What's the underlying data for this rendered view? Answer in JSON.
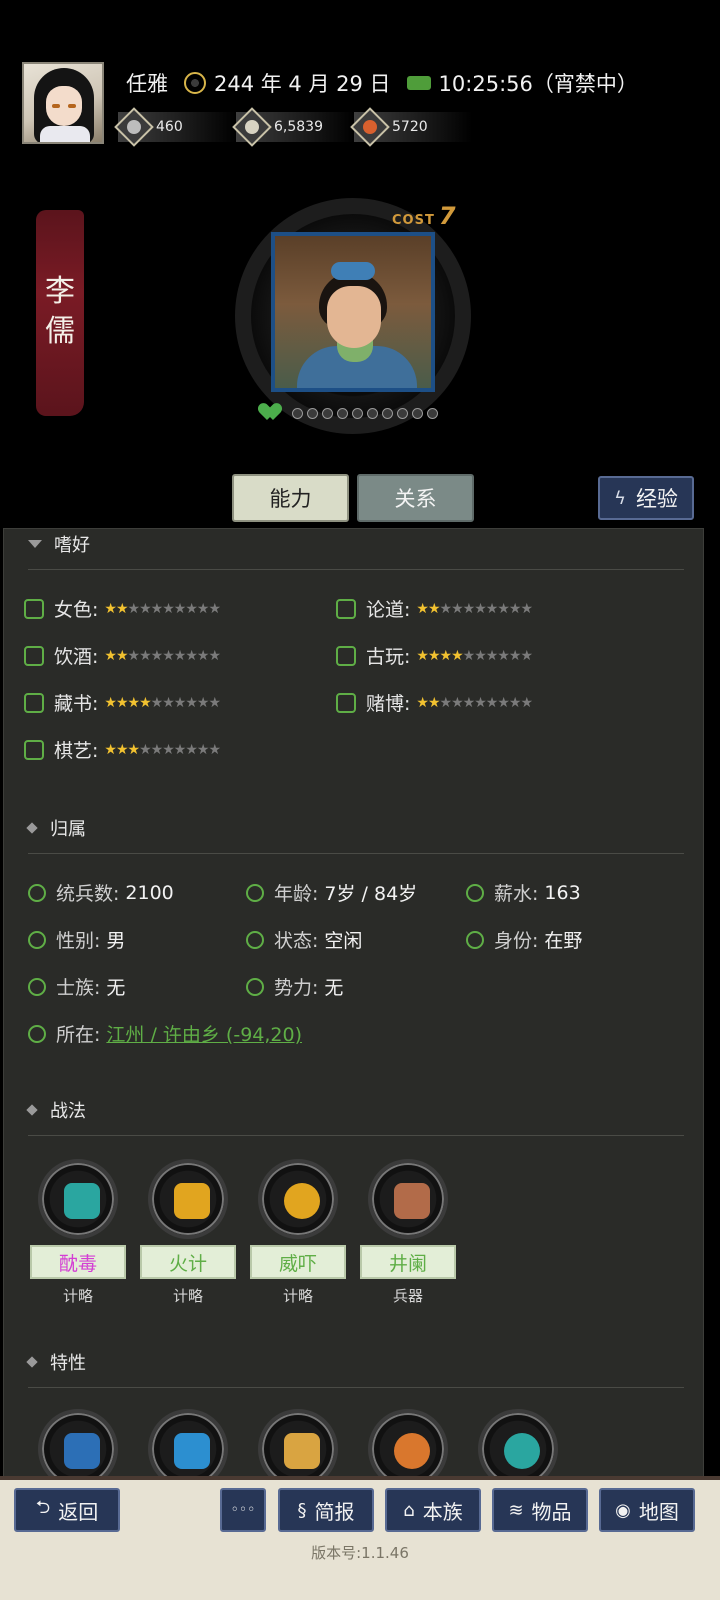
{
  "header": {
    "player_name": "任雅",
    "date": "244 年 4 月 29 日",
    "time": "10:25:56（宵禁中）",
    "resources": [
      {
        "icon": "coin-icon",
        "value": "460"
      },
      {
        "icon": "grain-icon",
        "value": "6,5839"
      },
      {
        "icon": "meat-icon",
        "value": "5720"
      }
    ]
  },
  "character": {
    "name_line1": "李",
    "name_line2": "儒",
    "cost_label": "COST",
    "cost_value": "7"
  },
  "tabs": {
    "ability": "能力",
    "relation": "关系",
    "experience": "经验"
  },
  "hobbies": {
    "section_title": "嗜好",
    "items": [
      {
        "label": "女色:",
        "stars": 2
      },
      {
        "label": "论道:",
        "stars": 1.5
      },
      {
        "label": "饮酒:",
        "stars": 2
      },
      {
        "label": "古玩:",
        "stars": 4
      },
      {
        "label": "藏书:",
        "stars": 4
      },
      {
        "label": "赌博:",
        "stars": 2
      },
      {
        "label": "棋艺:",
        "stars": 3
      }
    ]
  },
  "belong": {
    "section_title": "归属",
    "troops_label": "统兵数:",
    "troops_value": "2100",
    "age_label": "年龄:",
    "age_value": "7岁 / 84岁",
    "salary_label": "薪水:",
    "salary_value": "163",
    "gender_label": "性别:",
    "gender_value": "男",
    "status_label": "状态:",
    "status_value": "空闲",
    "identity_label": "身份:",
    "identity_value": "在野",
    "clan_label": "士族:",
    "clan_value": "无",
    "faction_label": "势力:",
    "faction_value": "无",
    "location_label": "所在:",
    "location_value": "江州 / 许由乡 (-94,20)"
  },
  "tactics": {
    "section_title": "战法",
    "items": [
      {
        "name": "酖毒",
        "category": "计略",
        "color": "#d43fd4"
      },
      {
        "name": "火计",
        "category": "计略",
        "color": "#5fae46"
      },
      {
        "name": "威吓",
        "category": "计略",
        "color": "#5fae46"
      },
      {
        "name": "井阑",
        "category": "兵器",
        "color": "#5fae46"
      }
    ]
  },
  "traits": {
    "section_title": "特性"
  },
  "bottom_bar": {
    "back": "返回",
    "more": "◦◦◦",
    "report": "简报",
    "clan": "本族",
    "items": "物品",
    "map": "地图",
    "version": "版本号:1.1.46"
  }
}
